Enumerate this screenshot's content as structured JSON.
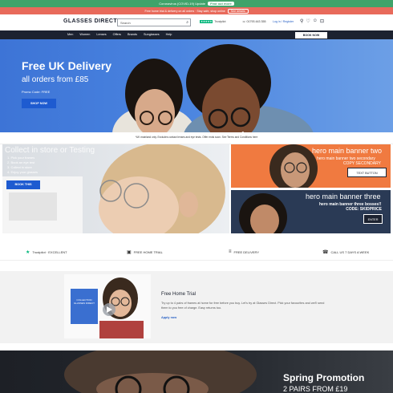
{
  "promo_bar": {
    "text": "Coronavirus (COVID-19) Update",
    "button": "Find out more"
  },
  "covid_bar": {
    "text": "Free home trial & delivery on all orders · Stay safe, shop online",
    "button": "See details"
  },
  "header": {
    "logo": "GLASSES DIRECT",
    "search_placeholder": "Search",
    "trustpilot_stars": "★★★★★",
    "trustpilot_label": "Trustpilot",
    "phone": "01793 443 355",
    "login": "Log in / Register"
  },
  "nav": {
    "items": [
      "Men",
      "Women",
      "Lenses",
      "Offers",
      "Brands",
      "Sunglasses",
      "Help"
    ],
    "book_button": "BOOK NOW"
  },
  "hero": {
    "title": "Free UK Delivery",
    "subtitle": "all orders from £85",
    "promo_code": "Promo Code: FREE",
    "button": "SHOP NOW"
  },
  "terms": {
    "text": "*UK mainland only. Excludes contact lenses and eye tests. Offer ends soon. See Terms and Conditions here"
  },
  "tile_main": {
    "heading": "Collect in store or Testing",
    "steps": [
      "1. Pick your frames",
      "2. Book an eye test",
      "3. Collect in store",
      "4. Enjoy your glasses"
    ],
    "button": "BOOK THIS"
  },
  "tile_two": {
    "title": "hero main banner two",
    "subtitle": [
      "hero main banner two secondary",
      "COPY SECONDARY"
    ],
    "button": "TEXT BUTTON"
  },
  "tile_three": {
    "title": "hero main banner three",
    "subtitle": [
      "hero main banner three bosses!!",
      "CODE: SKIDPRICE"
    ],
    "button": "ENTER"
  },
  "usps": [
    {
      "icon": "star-icon",
      "text": "Trustpilot · EXCELLENT"
    },
    {
      "icon": "box-icon",
      "text": "FREE HOME TRIAL"
    },
    {
      "icon": "truck-icon",
      "text": "FREE DELIVERY"
    },
    {
      "icon": "phone-icon",
      "text": "CALL US 7 DAYS A WEEK"
    }
  ],
  "home_trial": {
    "image_caption": "COLLECTION GLASSES DIRECT",
    "title": "Free Home Trial",
    "body": "Try up to 4 pairs of frames at home for free before you buy. Let's try at Glasses Direct. Pick your favourites and we'll send them to you free of charge. Easy returns too.",
    "link": "Apply now"
  },
  "spring": {
    "title": "Spring Promotion",
    "subtitle": "2 PAIRS FROM £19"
  },
  "colors": {
    "promo_green": "#3fa36a",
    "covid_coral": "#e86a5b",
    "nav_navy": "#1c2230",
    "hero_blue": "#4a84e0",
    "button_blue": "#1e5bd0",
    "tile_orange": "#f07a40"
  }
}
